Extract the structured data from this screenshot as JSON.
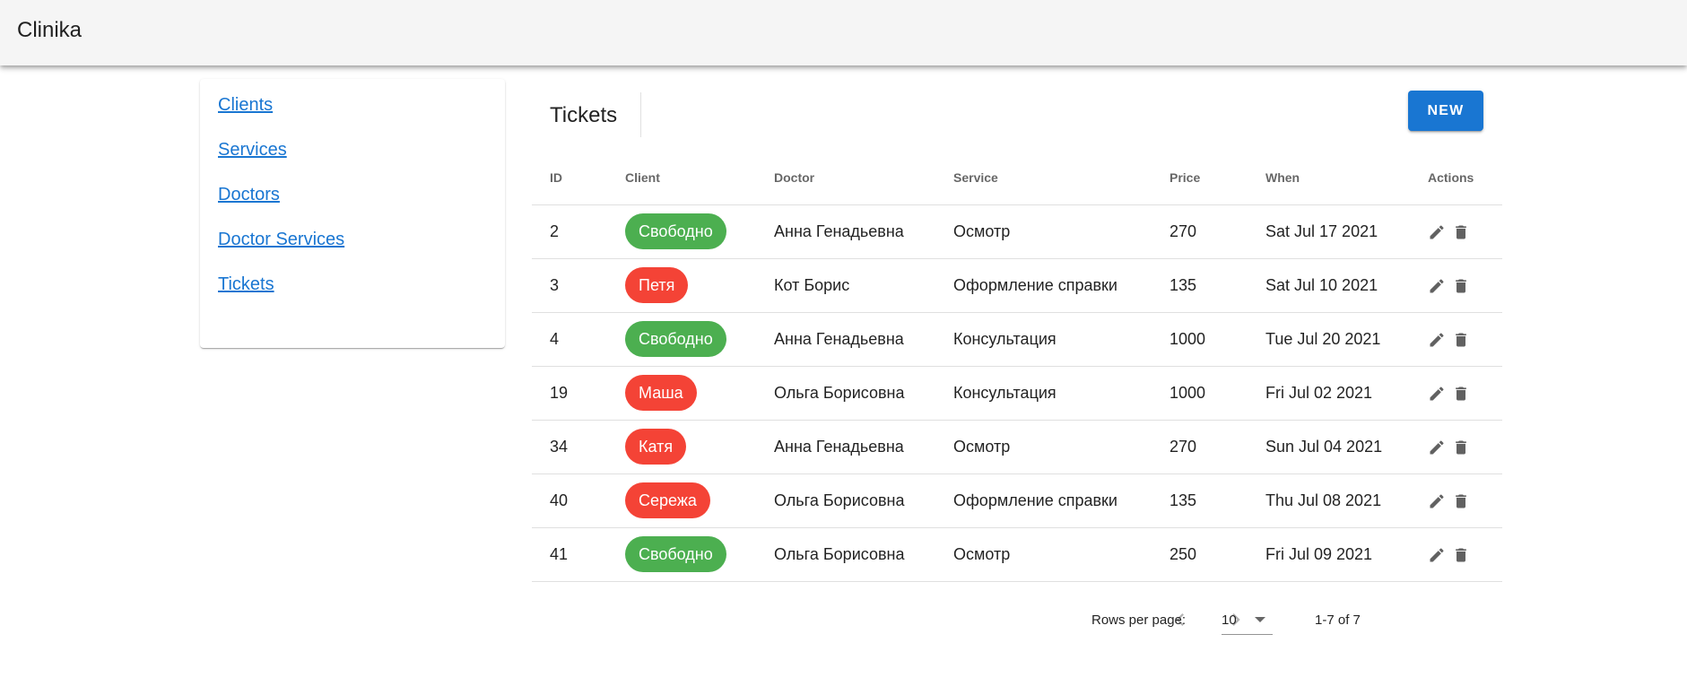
{
  "app": {
    "title": "Clinika"
  },
  "sidebar": {
    "items": [
      {
        "label": "Clients"
      },
      {
        "label": "Services"
      },
      {
        "label": "Doctors"
      },
      {
        "label": "Doctor Services"
      },
      {
        "label": "Tickets"
      }
    ]
  },
  "main": {
    "title": "Tickets",
    "new_button": "NEW"
  },
  "table": {
    "columns": [
      "ID",
      "Client",
      "Doctor",
      "Service",
      "Price",
      "When",
      "Actions"
    ],
    "rows": [
      {
        "id": "2",
        "client": "Свободно",
        "client_color": "#4caf50",
        "doctor": "Анна Генадьевна",
        "service": "Осмотр",
        "price": "270",
        "when": "Sat Jul 17 2021"
      },
      {
        "id": "3",
        "client": "Петя",
        "client_color": "#f44336",
        "doctor": "Кот Борис",
        "service": "Оформление справки",
        "price": "135",
        "when": "Sat Jul 10 2021"
      },
      {
        "id": "4",
        "client": "Свободно",
        "client_color": "#4caf50",
        "doctor": "Анна Генадьевна",
        "service": "Консультация",
        "price": "1000",
        "when": "Tue Jul 20 2021"
      },
      {
        "id": "19",
        "client": "Маша",
        "client_color": "#f44336",
        "doctor": "Ольга Борисовна",
        "service": "Консультация",
        "price": "1000",
        "when": "Fri Jul 02 2021"
      },
      {
        "id": "34",
        "client": "Катя",
        "client_color": "#f44336",
        "doctor": "Анна Генадьевна",
        "service": "Осмотр",
        "price": "270",
        "when": "Sun Jul 04 2021"
      },
      {
        "id": "40",
        "client": "Сережа",
        "client_color": "#f44336",
        "doctor": "Ольга Борисовна",
        "service": "Оформление справки",
        "price": "135",
        "when": "Thu Jul 08 2021"
      },
      {
        "id": "41",
        "client": "Свободно",
        "client_color": "#4caf50",
        "doctor": "Ольга Борисовна",
        "service": "Осмотр",
        "price": "250",
        "when": "Fri Jul 09 2021"
      }
    ],
    "row_actions": [
      "edit-icon",
      "delete-icon"
    ]
  },
  "pagination": {
    "rows_per_page_label": "Rows per page:",
    "rows_per_page_value": "10",
    "range": "1-7 of 7",
    "prev_enabled": false,
    "next_enabled": false
  },
  "colors": {
    "accent": "#1976d2",
    "chip_free": "#4caf50",
    "chip_booked": "#f44336",
    "app_bar": "#f5f5f5"
  }
}
